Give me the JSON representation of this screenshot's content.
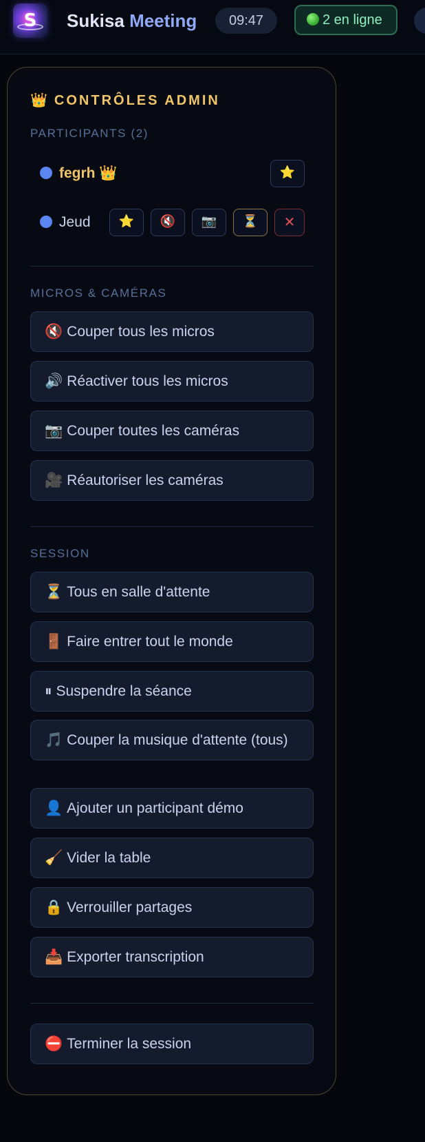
{
  "header": {
    "brand_first": "Sukisa",
    "brand_second": "Meeting",
    "logo_letter": "S",
    "clock": "09:47",
    "online_count": "2 en ligne"
  },
  "admin_panel": {
    "crown": "👑",
    "title": "CONTRÔLES ADMIN",
    "participants_label": "PARTICIPANTS (2)",
    "participants": [
      {
        "name": "fegrh",
        "badge": "👑",
        "is_host": true,
        "actions": [
          "⭐"
        ]
      },
      {
        "name": "Jeud",
        "badge": "",
        "is_host": false,
        "actions": [
          "⭐",
          "🔇",
          "📷",
          "⏳",
          "✕"
        ]
      }
    ],
    "mics_cameras_label": "MICROS & CAMÉRAS",
    "mics_cameras_actions": [
      {
        "icon": "🔇",
        "label": "Couper tous les micros"
      },
      {
        "icon": "🔊",
        "label": "Réactiver tous les micros"
      },
      {
        "icon": "📷",
        "label": "Couper toutes les caméras"
      },
      {
        "icon": "🎥",
        "label": "Réautoriser les caméras"
      }
    ],
    "session_label": "SESSION",
    "session_actions": [
      {
        "icon": "⏳",
        "label": "Tous en salle d'attente"
      },
      {
        "icon": "🚪",
        "label": "Faire entrer tout le monde"
      },
      {
        "icon": "⏸",
        "label": "Suspendre la séance"
      },
      {
        "icon": "🎵",
        "label": "Couper la musique d'attente (tous)"
      },
      {
        "icon": "👤",
        "label": "Ajouter un participant démo"
      },
      {
        "icon": "🧹",
        "label": "Vider la table"
      },
      {
        "icon": "🔒",
        "label": "Verrouiller partages"
      },
      {
        "icon": "📥",
        "label": "Exporter transcription"
      }
    ],
    "end_action": {
      "icon": "⛔",
      "label": "Terminer la session"
    }
  },
  "colors": {
    "accent_gold": "#f0c56a",
    "online_green": "#8ff0c1",
    "panel_border": "#4c4634",
    "participant_dot": "#5b86f2",
    "danger": "#e0515a"
  }
}
